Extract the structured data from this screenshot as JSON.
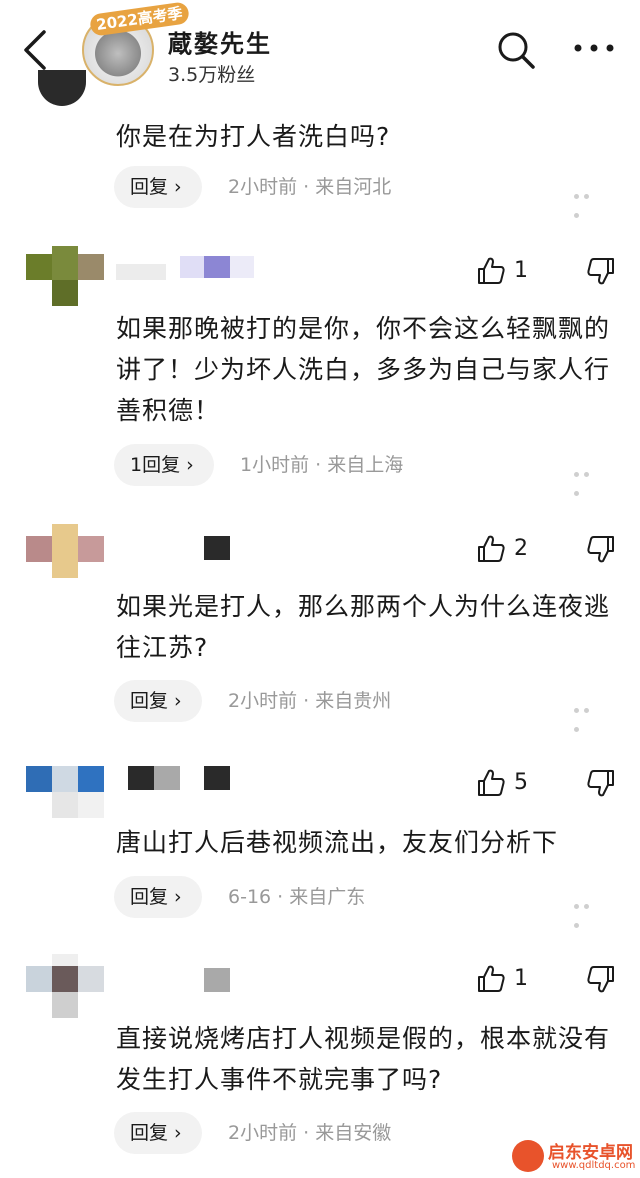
{
  "header": {
    "title": "蔵嫯先生",
    "subtitle": "3.5万粉丝",
    "badge": "2022高考季"
  },
  "comments": [
    {
      "text": "你是在为打人者洗白吗?",
      "reply_label": "回复 ›",
      "time": "2小时前",
      "location": "来自河北"
    },
    {
      "likes": "1",
      "text": "如果那晚被打的是你，你不会这么轻飘飘的讲了！少为坏人洗白，多多为自己与家人行善积德！",
      "reply_label": "1回复 ›",
      "time": "1小时前",
      "location": "来自上海"
    },
    {
      "likes": "2",
      "text": "如果光是打人，那么那两个人为什么连夜逃往江苏?",
      "reply_label": "回复 ›",
      "time": "2小时前",
      "location": "来自贵州"
    },
    {
      "likes": "5",
      "text": "唐山打人后巷视频流出，友友们分析下",
      "reply_label": "回复 ›",
      "time": "6-16",
      "location": "来自广东"
    },
    {
      "likes": "1",
      "text": "直接说烧烤店打人视频是假的，根本就没有发生打人事件不就完事了吗?",
      "reply_label": "回复 ›",
      "time": "2小时前",
      "location": "来自安徽"
    }
  ],
  "meta_separator": "·",
  "watermark": {
    "name": "启东安卓网",
    "url": "www.qdltdq.com"
  },
  "colors": {
    "accent": "#e8532b",
    "meta_text": "#999999",
    "reply_bg": "#f2f2f2"
  }
}
